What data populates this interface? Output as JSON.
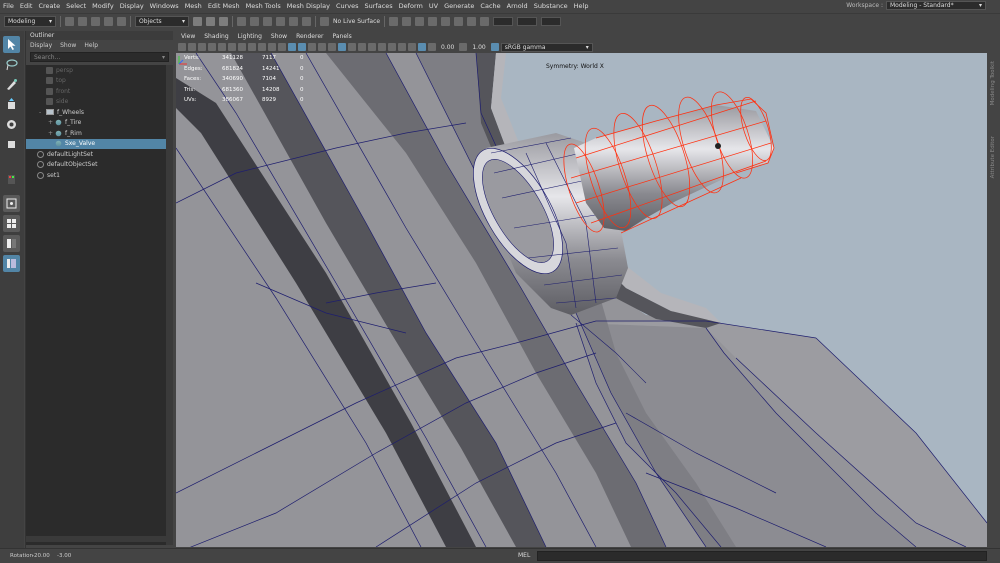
{
  "menubar": {
    "items": [
      "File",
      "Edit",
      "Create",
      "Select",
      "Modify",
      "Display",
      "Windows",
      "Mesh",
      "Edit Mesh",
      "Mesh Tools",
      "Mesh Display",
      "Curves",
      "Surfaces",
      "Deform",
      "UV",
      "Generate",
      "Cache",
      "Arnold",
      "Substance",
      "Help"
    ],
    "workspace_label": "Workspace :",
    "workspace_value": "Modeling - Standard*"
  },
  "statusline": {
    "mode": "Modeling",
    "select_mode": "Objects",
    "live_surface": "No Live Surface"
  },
  "outliner": {
    "title": "Outliner",
    "menu": [
      "Display",
      "Show",
      "Help"
    ],
    "search_placeholder": "Search...",
    "items": [
      {
        "label": "persp",
        "indent": 1,
        "icon": "camera-icon",
        "dim": true
      },
      {
        "label": "top",
        "indent": 1,
        "icon": "camera-icon",
        "dim": true
      },
      {
        "label": "front",
        "indent": 1,
        "icon": "camera-icon",
        "dim": true
      },
      {
        "label": "side",
        "indent": 1,
        "icon": "camera-icon",
        "dim": true
      },
      {
        "label": "f_Wheels",
        "indent": 1,
        "icon": "group-icon",
        "expander": "-"
      },
      {
        "label": "f_Tire",
        "indent": 2,
        "icon": "mesh-icon",
        "expander": "+"
      },
      {
        "label": "f_Rim",
        "indent": 2,
        "icon": "mesh-icon",
        "expander": "+"
      },
      {
        "label": "Sxe_Valve",
        "indent": 2,
        "icon": "mesh-icon",
        "selected": true
      },
      {
        "label": "defaultLightSet",
        "indent": 0,
        "icon": "set-icon"
      },
      {
        "label": "defaultObjectSet",
        "indent": 0,
        "icon": "set-icon"
      },
      {
        "label": "set1",
        "indent": 0,
        "icon": "set-icon"
      }
    ]
  },
  "viewport": {
    "menu": [
      "View",
      "Shading",
      "Lighting",
      "Show",
      "Renderer",
      "Panels"
    ],
    "exposure": "0.00",
    "gamma": "1.00",
    "color_space": "sRGB gamma",
    "symmetry": "Symmetry: World X",
    "hud": [
      {
        "label": "Verts:",
        "v1": "341128",
        "v2": "7117",
        "v3": "0"
      },
      {
        "label": "Edges:",
        "v1": "681824",
        "v2": "14241",
        "v3": "0"
      },
      {
        "label": "Faces:",
        "v1": "340690",
        "v2": "7104",
        "v3": "0"
      },
      {
        "label": "Tris:",
        "v1": "681360",
        "v2": "14208",
        "v3": "0"
      },
      {
        "label": "UVs:",
        "v1": "386067",
        "v2": "8929",
        "v3": "0"
      }
    ]
  },
  "sidestrip": {
    "labels": [
      "Modeling Toolkit",
      "Attribute Editor"
    ]
  },
  "bottombar": {
    "rotation_label": "Rotation",
    "rotation_v1": "-20.00",
    "rotation_v2": "-3.00",
    "mel_label": "MEL"
  },
  "colors": {
    "selection_blue": "#5285a6",
    "viewport_bg": "#a9b6c2",
    "mesh_wire": "#1e1e6e",
    "selected_wire": "#ff3010"
  }
}
